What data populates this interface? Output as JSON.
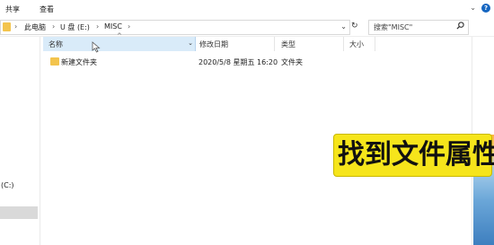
{
  "ribbon": {
    "tab_share": "共享",
    "tab_view": "查看",
    "collapse": "⌄",
    "help": "?"
  },
  "address": {
    "crumbs": [
      "此电脑",
      "U 盘 (E:)",
      "MISC"
    ],
    "separators": [
      "›",
      "›",
      "›",
      "›"
    ],
    "dropdown": "⌄"
  },
  "refresh": "↻",
  "search": {
    "placeholder": "搜索\"MISC\"",
    "icon": "search-icon"
  },
  "nav": {
    "drive_label": "(C:)"
  },
  "columns": {
    "name": "名称",
    "date": "修改日期",
    "type": "类型",
    "size": "大小",
    "sort_arrow": "^",
    "filter_arrow": "⌄"
  },
  "files": [
    {
      "name": "新建文件夹",
      "date": "2020/5/8 星期五 16:20",
      "type": "文件夹",
      "size": ""
    }
  ],
  "caption": {
    "text": "找到文件属性"
  },
  "colors": {
    "accent": "#1565c0",
    "header_sel": "#d9ebf9",
    "folder": "#f3c44d",
    "caption_bg": "#f6e51b"
  }
}
